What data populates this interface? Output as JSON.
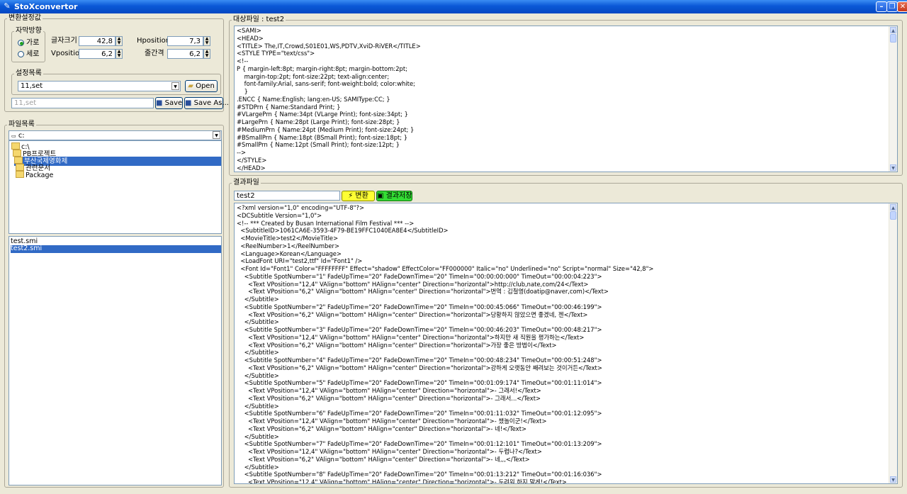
{
  "window": {
    "title": "StoXconvertor"
  },
  "settings": {
    "group_title": "변환설정값",
    "direction_title": "자막방향",
    "direction_options": [
      "가로",
      "세로"
    ],
    "font_size_label": "글자크기",
    "font_size_value": "42,8",
    "vposition_label": "Vposition",
    "vposition_value": "6,2",
    "hposition_label": "Hposition",
    "hposition_value": "7,3",
    "line_gap_label": "줄간격",
    "line_gap_value": "6,2",
    "preset_title": "설정목록",
    "preset_selected": "11,set",
    "open_label": "Open",
    "save_name_placeholder": "11,set",
    "save_label": "Save",
    "save_as_label": "Save As..."
  },
  "files": {
    "group_title": "파일목록",
    "drive": "c:",
    "tree": [
      "c:\\",
      "PB프로젝트",
      "부산국제영화제",
      "관련문서",
      "Package"
    ],
    "list": [
      "test.smi",
      "test2.smi"
    ]
  },
  "source": {
    "title": "대상파일 : test2",
    "lines": [
      "<SAMI>",
      "<HEAD>",
      "<TITLE> The,IT,Crowd,S01E01,WS,PDTV,XviD-RiVER</TITLE>",
      "<STYLE TYPE=\"text/css\">",
      "<!--",
      "P { margin-left:8pt; margin-right:8pt; margin-bottom:2pt;",
      "    margin-top:2pt; font-size:22pt; text-align:center;",
      "    font-family:Arial, sans-serif; font-weight:bold; color:white;",
      "    }",
      ".ENCC { Name:English; lang:en-US; SAMIType:CC; }",
      "#STDPrn { Name:Standard Print; }",
      "#VLargePrn { Name:34pt (VLarge Print); font-size:34pt; }",
      "#LargePrn { Name:28pt (Large Print); font-size:28pt; }",
      "#MediumPrn { Name:24pt (Medium Print); font-size:24pt; }",
      "#BSmallPrn { Name:18pt (BSmall Print); font-size:18pt; }",
      "#SmallPrn { Name:12pt (Small Print); font-size:12pt; }",
      "-->",
      "</STYLE>",
      "</HEAD>"
    ]
  },
  "result": {
    "title": "결과파일",
    "filename": "test2",
    "convert_label": "변환",
    "save_result_label": "결과저장",
    "lines": [
      "<?xml version=\"1,0\" encoding=\"UTF-8\"?>",
      "<DCSubtitle Version=\"1,0\">",
      "<!-- *** Created by Busan International Film Festival *** -->",
      "  <SubtitleID>1061CA6E-3593-4F79-BE19FFC1040EA8E4</SubtitleID>",
      "  <MovieTitle>test2</MovieTitle>",
      "  <ReelNumber>1</ReelNumber>",
      "  <Language>Korean</Language>",
      "  <LoadFont URI=\"test2,ttf\" Id=\"Font1\" />",
      "  <Font Id=\"Font1\" Color=\"FFFFFFFF\" Effect=\"shadow\" EffectColor=\"FF000000\" Italic=\"no\" Underlined=\"no\" Script=\"normal\" Size=\"42,8\">",
      "    <Subtitle SpotNumber=\"1\" FadeUpTime=\"20\" FadeDownTime=\"20\" TimeIn=\"00:00:00:000\" TimeOut=\"00:00:04:223\">",
      "      <Text VPosition=\"12,4\" VAlign=\"bottom\" HAlign=\"center\" Direction=\"horizontal\">http://club,nate,com/24</Text>",
      "      <Text VPosition=\"6,2\" VAlign=\"bottom\" HAlign=\"center\" Direction=\"horizontal\">번역 : 김철영(doatip@naver,com)</Text>",
      "    </Subtitle>",
      "    <Subtitle SpotNumber=\"2\" FadeUpTime=\"20\" FadeDownTime=\"20\" TimeIn=\"00:00:45:066\" TimeOut=\"00:00:46:199\">",
      "      <Text VPosition=\"6,2\" VAlign=\"bottom\" HAlign=\"center\" Direction=\"horizontal\">당황하지 않았으면 좋겠네, 젠</Text>",
      "    </Subtitle>",
      "    <Subtitle SpotNumber=\"3\" FadeUpTime=\"20\" FadeDownTime=\"20\" TimeIn=\"00:00:46:203\" TimeOut=\"00:00:48:217\">",
      "      <Text VPosition=\"12,4\" VAlign=\"bottom\" HAlign=\"center\" Direction=\"horizontal\">하지만 새 직원을 평가하는</Text>",
      "      <Text VPosition=\"6,2\" VAlign=\"bottom\" HAlign=\"center\" Direction=\"horizontal\">가장 좋은 방법이</Text>",
      "    </Subtitle>",
      "    <Subtitle SpotNumber=\"4\" FadeUpTime=\"20\" FadeDownTime=\"20\" TimeIn=\"00:00:48:234\" TimeOut=\"00:00:51:248\">",
      "      <Text VPosition=\"6,2\" VAlign=\"bottom\" HAlign=\"center\" Direction=\"horizontal\">강하게 오랫동안 째려보는 것이거든</Text>",
      "    </Subtitle>",
      "    <Subtitle SpotNumber=\"5\" FadeUpTime=\"20\" FadeDownTime=\"20\" TimeIn=\"00:01:09:174\" TimeOut=\"00:01:11:014\">",
      "      <Text VPosition=\"12,4\" VAlign=\"bottom\" HAlign=\"center\" Direction=\"horizontal\">- 그래서!</Text>",
      "      <Text VPosition=\"6,2\" VAlign=\"bottom\" HAlign=\"center\" Direction=\"horizontal\">- 그래서...</Text>",
      "    </Subtitle>",
      "    <Subtitle SpotNumber=\"6\" FadeUpTime=\"20\" FadeDownTime=\"20\" TimeIn=\"00:01:11:032\" TimeOut=\"00:01:12:095\">",
      "      <Text VPosition=\"12,4\" VAlign=\"bottom\" HAlign=\"center\" Direction=\"horizontal\">- 챘놀이군!</Text>",
      "      <Text VPosition=\"6,2\" VAlign=\"bottom\" HAlign=\"center\" Direction=\"horizontal\">- 네!</Text>",
      "    </Subtitle>",
      "    <Subtitle SpotNumber=\"7\" FadeUpTime=\"20\" FadeDownTime=\"20\" TimeIn=\"00:01:12:101\" TimeOut=\"00:01:13:209\">",
      "      <Text VPosition=\"12,4\" VAlign=\"bottom\" HAlign=\"center\" Direction=\"horizontal\">- 두렵나?</Text>",
      "      <Text VPosition=\"6,2\" VAlign=\"bottom\" HAlign=\"center\" Direction=\"horizontal\">- 네,,,</Text>",
      "    </Subtitle>",
      "    <Subtitle SpotNumber=\"8\" FadeUpTime=\"20\" FadeDownTime=\"20\" TimeIn=\"00:01:13:212\" TimeOut=\"00:01:16:036\">",
      "      <Text VPosition=\"12,4\" VAlign=\"bottom\" HAlign=\"center\" Direction=\"horizontal\">- 두려워 하지 말게!</Text>"
    ]
  }
}
